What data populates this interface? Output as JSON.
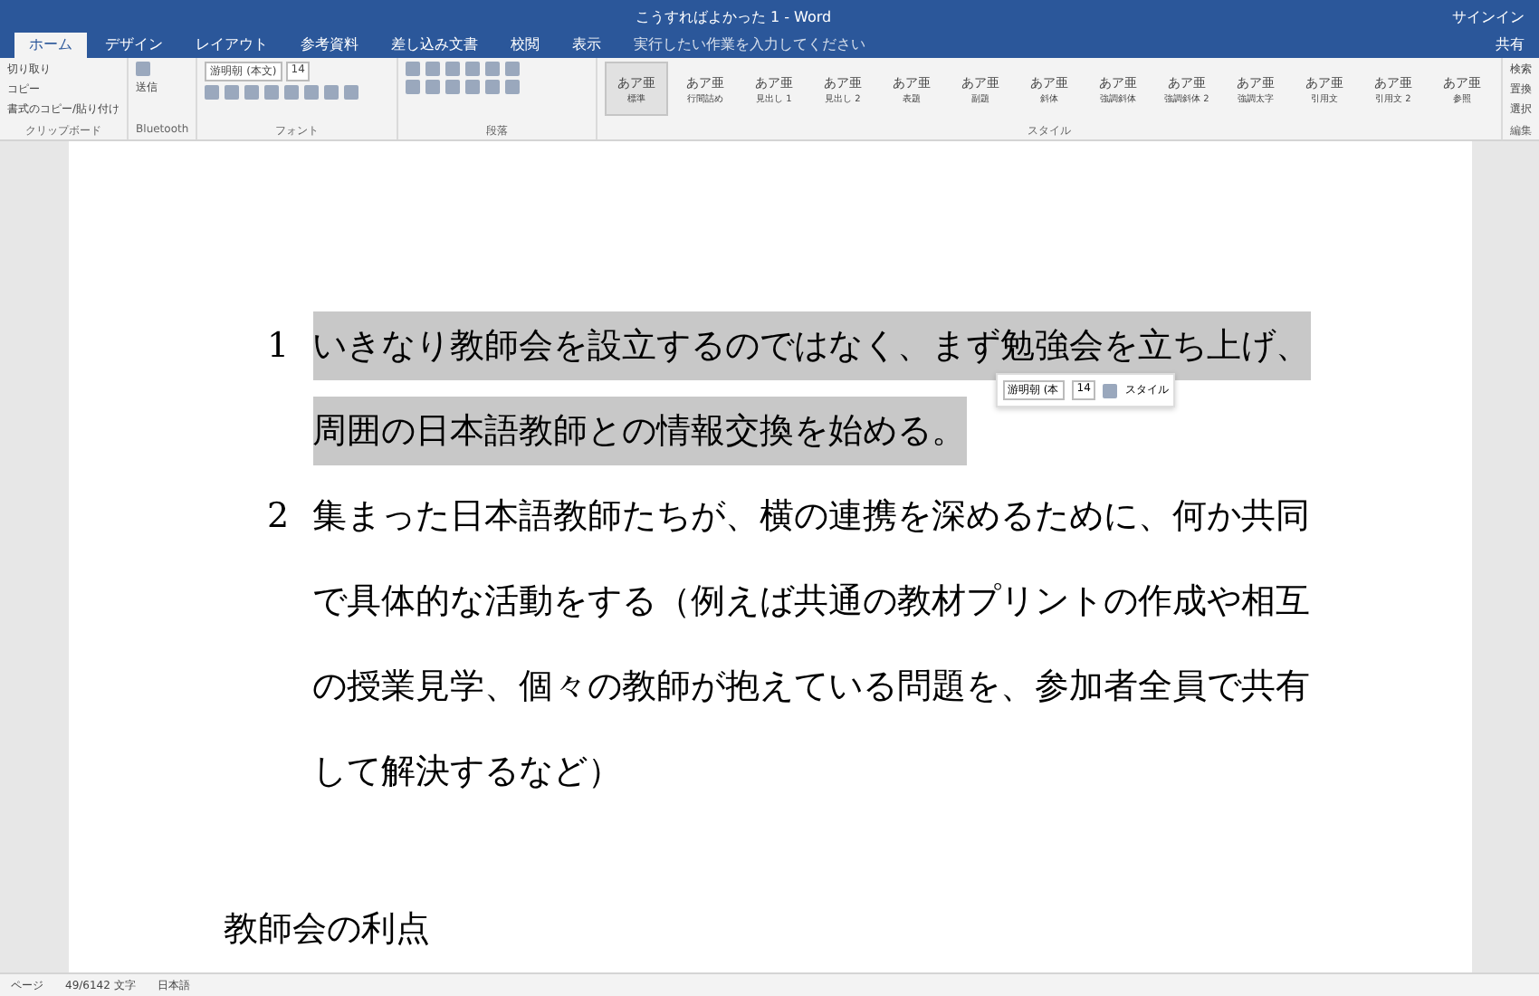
{
  "window": {
    "title": "こうすればよかった 1 - Word",
    "sign_in": "サインイン",
    "share": "共有"
  },
  "tabs": [
    {
      "label": "ホーム",
      "selected": true
    },
    {
      "label": "デザイン",
      "selected": false
    },
    {
      "label": "レイアウト",
      "selected": false
    },
    {
      "label": "参考資料",
      "selected": false
    },
    {
      "label": "差し込み文書",
      "selected": false
    },
    {
      "label": "校閲",
      "selected": false
    },
    {
      "label": "表示",
      "selected": false
    }
  ],
  "tell_me": {
    "placeholder": "実行したい作業を入力してください"
  },
  "clipboard": {
    "items": [
      "切り取り",
      "コピー",
      "書式のコピー/貼り付け"
    ],
    "label": "クリップボード"
  },
  "bluetooth": {
    "label": "Bluetooth",
    "button": "送信"
  },
  "font": {
    "name": "游明朝 (本文)",
    "size": "14",
    "label": "フォント"
  },
  "paragraph": {
    "label": "段落"
  },
  "styles": {
    "label": "スタイル",
    "items": [
      {
        "sample": "あア亜",
        "name": "標準",
        "selected": true
      },
      {
        "sample": "あア亜",
        "name": "行間詰め",
        "selected": false
      },
      {
        "sample": "あア亜",
        "name": "見出し 1",
        "selected": false
      },
      {
        "sample": "あア亜",
        "name": "見出し 2",
        "selected": false
      },
      {
        "sample": "あア亜",
        "name": "表題",
        "selected": false
      },
      {
        "sample": "あア亜",
        "name": "副題",
        "selected": false
      },
      {
        "sample": "あア亜",
        "name": "斜体",
        "selected": false
      },
      {
        "sample": "あア亜",
        "name": "強調斜体",
        "selected": false
      },
      {
        "sample": "あア亜",
        "name": "強調斜体 2",
        "selected": false
      },
      {
        "sample": "あア亜",
        "name": "強調太字",
        "selected": false
      },
      {
        "sample": "あア亜",
        "name": "引用文",
        "selected": false
      },
      {
        "sample": "あア亜",
        "name": "引用文 2",
        "selected": false
      },
      {
        "sample": "あア亜",
        "name": "参照",
        "selected": false
      }
    ]
  },
  "editing": {
    "items": [
      "検索",
      "置換",
      "選択"
    ],
    "label": "編集"
  },
  "document": {
    "items": [
      {
        "number": "1",
        "selected": true,
        "lines": [
          "いきなり教師会を設立するのではなく、まず勉強会を立ち上げ、",
          "周囲の日本語教師との情報交換を始める。"
        ]
      },
      {
        "number": "2",
        "selected": false,
        "lines": [
          "集まった日本語教師たちが、横の連携を深めるために、何か共同",
          "で具体的な活動をする（例えば共通の教材プリントの作成や相互",
          "の授業見学、個々の教師が抱えている問題を、参加者全員で共有",
          "して解決するなど）"
        ]
      }
    ],
    "heading": "教師会の利点"
  },
  "mini_toolbar": {
    "font": "游明朝 (本",
    "size": "14",
    "styles": "スタイル"
  },
  "status_bar": {
    "page": "ページ",
    "words": "49/6142 文字",
    "language": "日本語"
  }
}
